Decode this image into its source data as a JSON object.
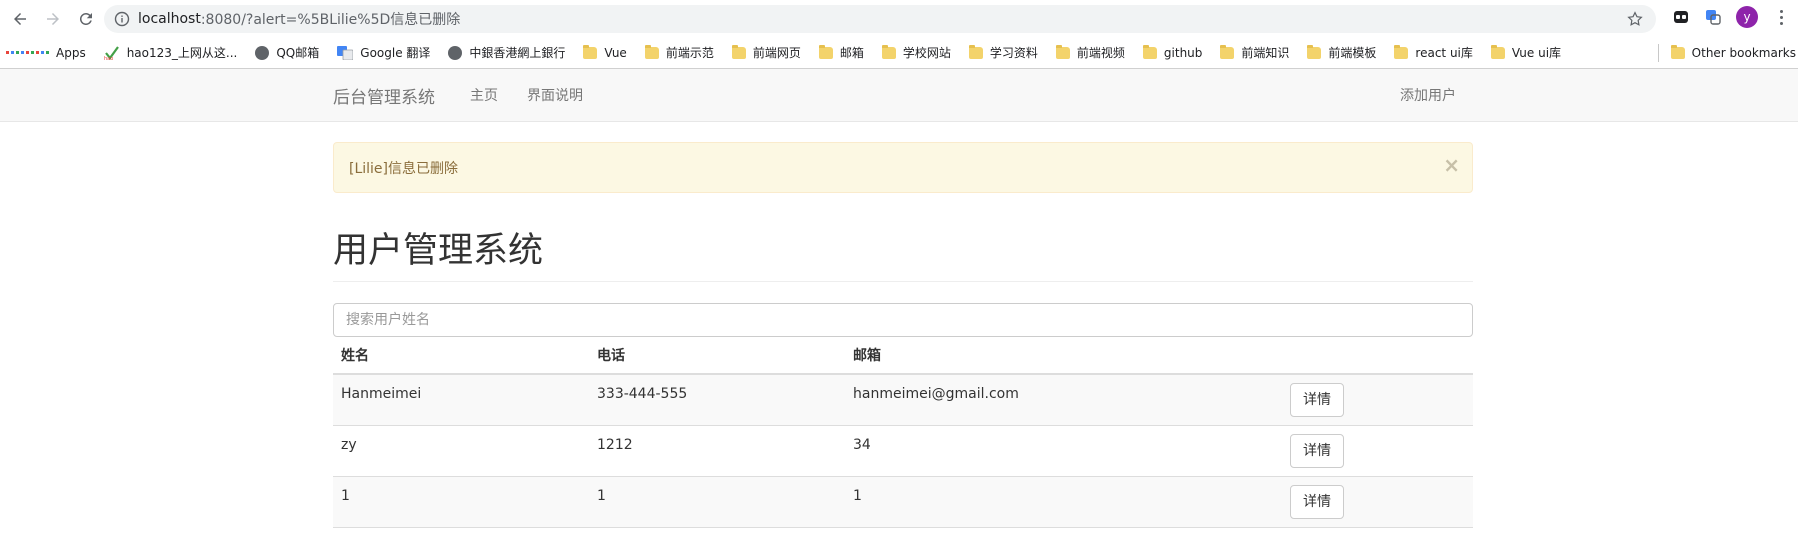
{
  "browser": {
    "url_host": "localhost",
    "url_rest": ":8080/?alert=%5BLilie%5D信息已删除",
    "profile_initial": "y"
  },
  "bookmarks": {
    "items": [
      {
        "label": "Apps",
        "icon": "apps-grid-icon"
      },
      {
        "label": "hao123_上网从这...",
        "icon": "hao123-icon"
      },
      {
        "label": "QQ邮箱",
        "icon": "globe-icon"
      },
      {
        "label": "Google 翻译",
        "icon": "google-translate-icon"
      },
      {
        "label": "中銀香港網上銀行",
        "icon": "globe-icon"
      },
      {
        "label": "Vue",
        "icon": "folder-icon"
      },
      {
        "label": "前端示范",
        "icon": "folder-icon"
      },
      {
        "label": "前端网页",
        "icon": "folder-icon"
      },
      {
        "label": "邮箱",
        "icon": "folder-icon"
      },
      {
        "label": "学校网站",
        "icon": "folder-icon"
      },
      {
        "label": "学习资料",
        "icon": "folder-icon"
      },
      {
        "label": "前端视频",
        "icon": "folder-icon"
      },
      {
        "label": "github",
        "icon": "folder-icon"
      },
      {
        "label": "前端知识",
        "icon": "folder-icon"
      },
      {
        "label": "前端模板",
        "icon": "folder-icon"
      },
      {
        "label": "react ui库",
        "icon": "folder-icon"
      },
      {
        "label": "Vue ui库",
        "icon": "folder-icon"
      }
    ],
    "other": "Other bookmarks"
  },
  "navbar": {
    "brand": "后台管理系统",
    "home": "主页",
    "about": "界面说明",
    "add_user": "添加用户"
  },
  "alert": {
    "message": "[Lilie]信息已删除",
    "close": "×"
  },
  "page": {
    "title": "用户管理系统"
  },
  "search": {
    "placeholder": "搜索用户姓名"
  },
  "table": {
    "headers": {
      "name": "姓名",
      "phone": "电话",
      "email": "邮箱"
    },
    "rows": [
      {
        "name": "Hanmeimei",
        "phone": "333-444-555",
        "email": "hanmeimei@gmail.com",
        "action": "详情"
      },
      {
        "name": "zy",
        "phone": "1212",
        "email": "34",
        "action": "详情"
      },
      {
        "name": "1",
        "phone": "1",
        "email": "1",
        "action": "详情"
      }
    ]
  },
  "colors": {
    "alert_bg": "#fcf8e3",
    "alert_text": "#8a6d3b",
    "navbar_bg": "#f8f8f8",
    "avatar": "#8e24aa"
  }
}
